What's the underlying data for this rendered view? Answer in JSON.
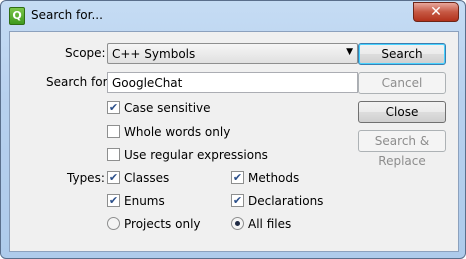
{
  "window": {
    "title": "Search for...",
    "close_glyph": "✕",
    "app_icon_glyph": "Q"
  },
  "scope": {
    "label": "Scope:",
    "selected": "C++ Symbols"
  },
  "search_for": {
    "label": "Search for:",
    "value": "GoogleChat"
  },
  "options": {
    "case_sensitive": {
      "label": "Case sensitive",
      "checked": true
    },
    "whole_words": {
      "label": "Whole words only",
      "checked": false
    },
    "regex": {
      "label": "Use regular expressions",
      "checked": false
    }
  },
  "types": {
    "label": "Types:",
    "classes": {
      "label": "Classes",
      "checked": true
    },
    "methods": {
      "label": "Methods",
      "checked": true
    },
    "enums": {
      "label": "Enums",
      "checked": true
    },
    "declarations": {
      "label": "Declarations",
      "checked": true
    },
    "projects_only": {
      "label": "Projects only",
      "selected": false
    },
    "all_files": {
      "label": "All files",
      "selected": true
    }
  },
  "buttons": {
    "search": "Search",
    "cancel": "Cancel",
    "close": "Close",
    "search_replace": "Search & Replace"
  },
  "check_glyph": "✔"
}
